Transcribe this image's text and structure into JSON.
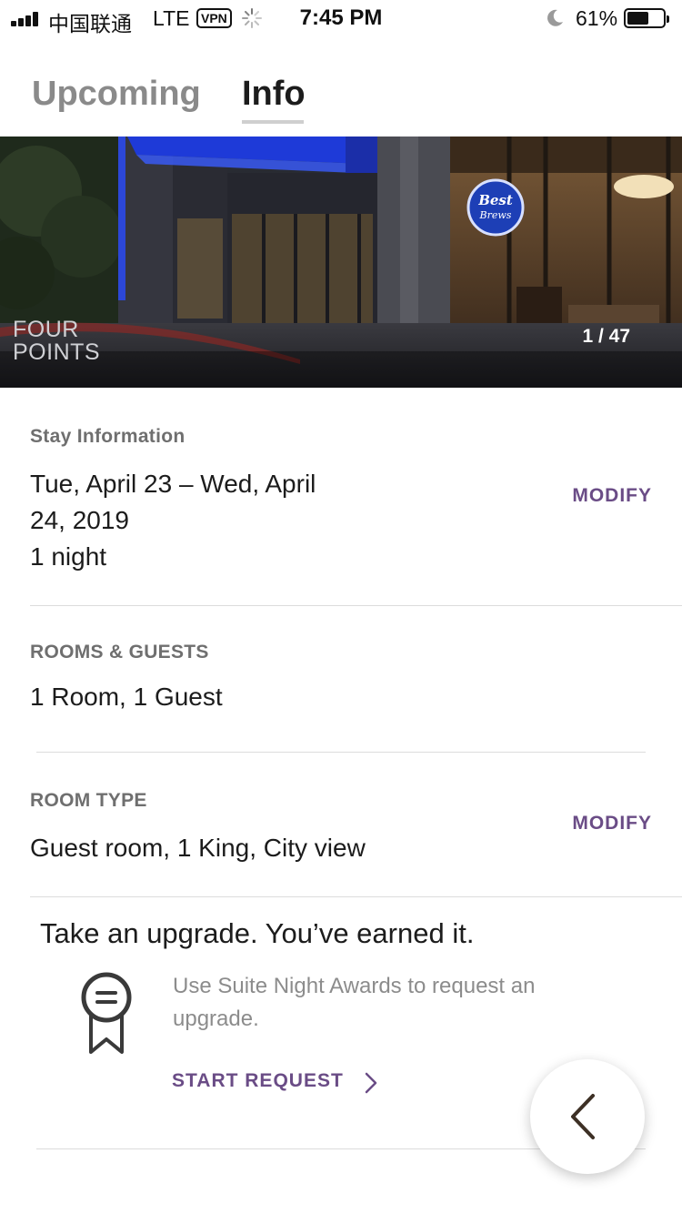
{
  "status_bar": {
    "carrier": "中国联通",
    "network": "LTE",
    "vpn": "VPN",
    "time": "7:45 PM",
    "battery_percent": "61%",
    "battery_level": 0.61
  },
  "tabs": [
    {
      "label": "Upcoming",
      "active": false
    },
    {
      "label": "Info",
      "active": true
    }
  ],
  "hero": {
    "logo_line1": "FOUR",
    "logo_line2": "POINTS",
    "counter": "1 / 47",
    "sign_text": "Best Brews"
  },
  "stay": {
    "label": "Stay Information",
    "dates_line1": "Tue, April 23 – Wed, April",
    "dates_line2": "24, 2019",
    "nights": "1 night",
    "modify_label": "MODIFY"
  },
  "rooms": {
    "label": "ROOMS & GUESTS",
    "value": "1 Room, 1 Guest"
  },
  "room_type": {
    "label": "ROOM TYPE",
    "value": "Guest room, 1 King, City view",
    "modify_label": "MODIFY"
  },
  "upgrade": {
    "title": "Take an upgrade. You’ve earned it.",
    "description": "Use Suite Night Awards to request an upgrade.",
    "cta": "START REQUEST"
  },
  "icons": {
    "award": "award-ribbon-icon",
    "chevron": "chevron-right-icon",
    "back": "chevron-left-icon"
  },
  "colors": {
    "accent": "#6a4c86",
    "muted": "#8a8a8a"
  }
}
